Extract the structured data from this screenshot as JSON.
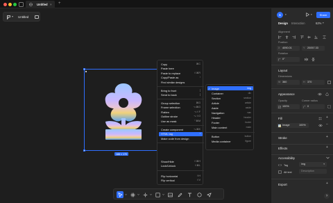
{
  "titlebar": {
    "tab_title": "Untitled",
    "close_glyph": "×",
    "new_tab_glyph": "+",
    "traffic_colors": [
      "#ff5f57",
      "#febc2e",
      "#28c840"
    ]
  },
  "canvas": {
    "file_name": "Untitled",
    "frame_size": "188 × 170"
  },
  "context_menu": {
    "items": [
      {
        "label": "Copy",
        "shortcut": "⌘C"
      },
      {
        "label": "Paste here",
        "shortcut": ""
      },
      {
        "label": "Paste to replace",
        "shortcut": "⇧⌘R"
      },
      {
        "label": "Copy/Paste as",
        "shortcut": "›"
      },
      {
        "label": "Find similar designs",
        "shortcut": ""
      },
      {
        "label": "Bring to front",
        "shortcut": "]"
      },
      {
        "label": "Send to back",
        "shortcut": "["
      },
      {
        "label": "Group selection",
        "shortcut": "⌘G"
      },
      {
        "label": "Frame selection",
        "shortcut": "⌥⌘G"
      },
      {
        "label": "Flatten",
        "shortcut": "⌥⇧F"
      },
      {
        "label": "Outline stroke",
        "shortcut": "⌥⇧O"
      },
      {
        "label": "Use as mask",
        "shortcut": "⌃⌘M"
      },
      {
        "label": "Create component",
        "shortcut": "⌥⌘K"
      },
      {
        "label": "HTML tag",
        "shortcut": "›"
      },
      {
        "label": "Make code from design",
        "shortcut": ""
      },
      {
        "label": "Show/Hide",
        "shortcut": "⇧⌘H"
      },
      {
        "label": "Lock/Unlock",
        "shortcut": "⇧⌘L"
      },
      {
        "label": "Flip horizontal",
        "shortcut": "⇧H"
      },
      {
        "label": "Flip vertical",
        "shortcut": "⇧V"
      }
    ]
  },
  "html_tag_submenu": {
    "items": [
      {
        "label": "Image",
        "tag": "img",
        "checked": true
      },
      {
        "label": "Container",
        "tag": "div",
        "checked": false
      },
      {
        "label": "Section",
        "tag": "section",
        "checked": false
      },
      {
        "label": "Article",
        "tag": "article",
        "checked": false
      },
      {
        "label": "Aside",
        "tag": "aside",
        "checked": false
      },
      {
        "label": "Navigation",
        "tag": "nav",
        "checked": false
      },
      {
        "label": "Header",
        "tag": "header",
        "checked": false
      },
      {
        "label": "Footer",
        "tag": "footer",
        "checked": false
      },
      {
        "label": "Main content",
        "tag": "main",
        "checked": false
      },
      {
        "label": "Button",
        "tag": "button",
        "checked": false
      },
      {
        "label": "Media container",
        "tag": "figure",
        "checked": false
      }
    ],
    "check_glyph": "✓"
  },
  "toolbar": {
    "tools": [
      "move-tool",
      "frame-tool",
      "pen-tool",
      "shape-tool",
      "image-tool",
      "pencil-tool",
      "text-tool",
      "comment-tool",
      "share-tool"
    ]
  },
  "panel": {
    "avatar_letter": "S",
    "share_label": "Share",
    "tab_design": "Design",
    "tab_interaction": "Interaction",
    "zoom": "62%",
    "alignment_label": "Alignment",
    "position_label": "Position",
    "x_value": "4090.01",
    "y_value": "20057.33",
    "rotation_label": "Rotation",
    "rotation_value": "0°",
    "layout_heading": "Layout",
    "dimensions_label": "Dimensions",
    "w_value": "360",
    "h_value": "370",
    "appearance_heading": "Appearance",
    "opacity_label": "Opacity",
    "opacity_value": "100%",
    "radius_label": "Corner radius",
    "radius_value": "0",
    "fill_heading": "Fill",
    "fill_type": "Image",
    "fill_opacity": "100%",
    "stroke_heading": "Stroke",
    "effects_heading": "Effects",
    "accessibility_heading": "Accessibility",
    "tag_label": "Tag",
    "tag_value": "img",
    "alt_label": "Alt text",
    "alt_placeholder": "Description",
    "export_heading": "Export",
    "help_glyph": "?"
  }
}
